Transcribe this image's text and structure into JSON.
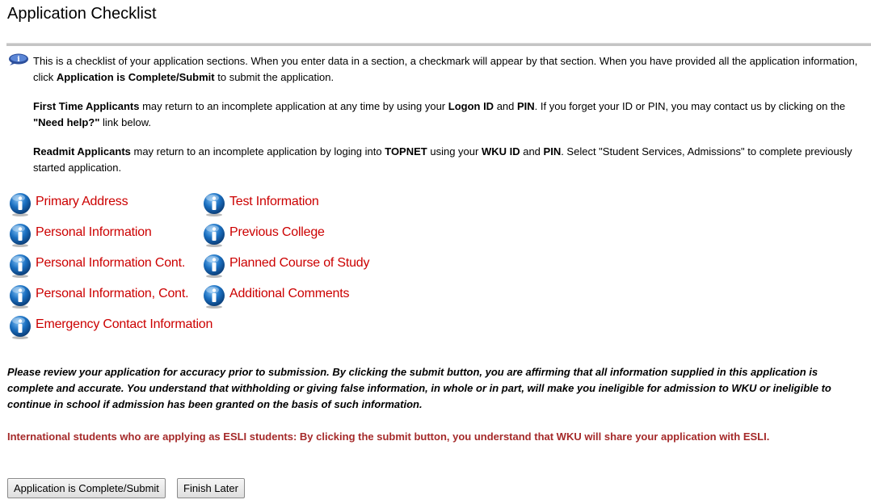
{
  "page_title": "Application Checklist",
  "intro": {
    "p1_a": "This is a checklist of your application sections. When you enter data in a section, a checkmark will appear by that section. When you have provided all the application information, click ",
    "p1_b": "Application is Complete/Submit",
    "p1_c": " to submit the application.",
    "p2_a": "First Time Applicants",
    "p2_b": " may return to an incomplete application at any time by using your ",
    "p2_c": "Logon ID",
    "p2_d": " and ",
    "p2_e": "PIN",
    "p2_f": ". If you forget your ID or PIN, you may contact us by clicking on the ",
    "p2_g": "\"Need help?\"",
    "p2_h": " link below.",
    "p3_a": "Readmit Applicants",
    "p3_b": " may return to an incomplete application by loging into ",
    "p3_c": "TOPNET",
    "p3_d": " using your ",
    "p3_e": "WKU ID",
    "p3_f": " and ",
    "p3_g": "PIN",
    "p3_h": ". Select \"Student Services, Admissions\" to complete previously started application."
  },
  "checklist": {
    "col1": [
      "Primary Address",
      "Personal Information",
      "Personal Information Cont.",
      "Personal Information, Cont.",
      "Emergency Contact Information"
    ],
    "col2": [
      "Test Information",
      "Previous College",
      "Planned Course of Study",
      "Additional Comments"
    ]
  },
  "disclaimer": "Please review your application for accuracy prior to submission. By clicking the submit button, you are affirming that all information supplied in this application is complete and accurate. You understand that withholding or giving false information, in whole or in part, will make you ineligible for admission to WKU or ineligible to continue in school if admission has been granted on the basis of such information.",
  "esli_notice": "International students who are applying as ESLI students: By clicking the submit button, you understand that WKU will share your application with ESLI.",
  "buttons": {
    "submit": "Application is Complete/Submit",
    "finish_later": "Finish Later"
  },
  "colors": {
    "link": "#cc0000",
    "esli_text": "#a52a2a",
    "rule": "#c4c4c4",
    "icon_blue": "#1a6fc0"
  },
  "icons": {
    "info_header": "info-icon",
    "section": "info-bubble-icon"
  }
}
